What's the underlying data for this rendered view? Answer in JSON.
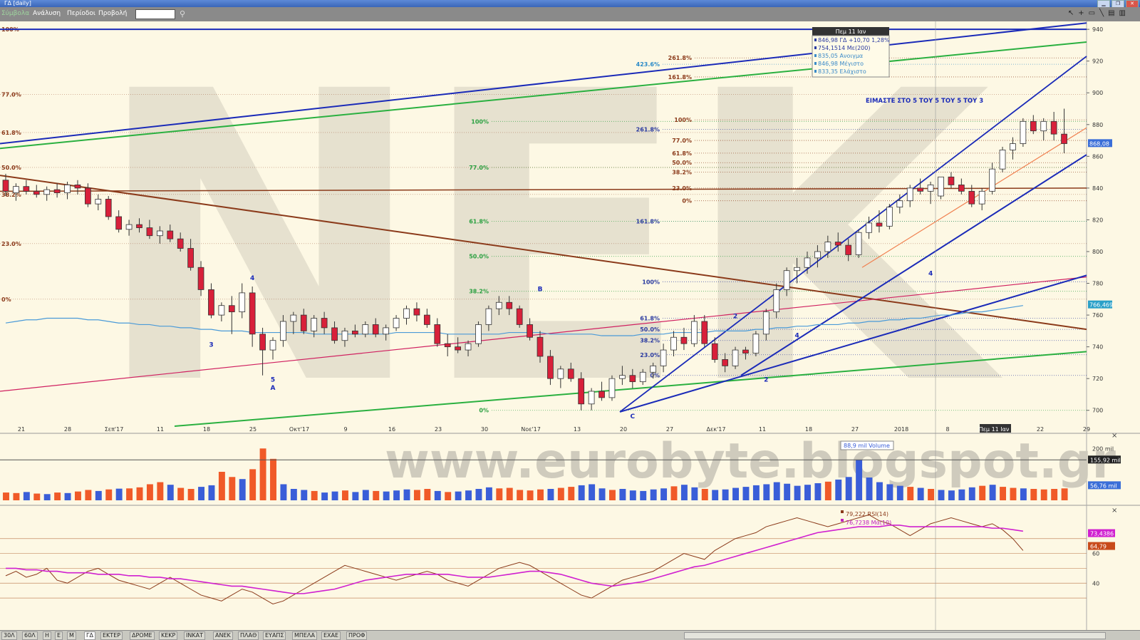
{
  "window": {
    "title": "ΓΔ [daily]"
  },
  "menu": [
    "Σύμβολα",
    "Ανάλυση",
    "Περίοδοι",
    "Προβολή"
  ],
  "watermark": "www.eurobyte.blogspot.gr",
  "crosshair_label": "Πεμ 11 Ιαν",
  "annotation": "ΕΙΜΑΣΤΕ ΣΤΟ 5 ΤΟΥ 5 ΤΟΥ 5 ΤΟΥ 3",
  "tooltip": {
    "header": "Πεμ 11 Ιαν",
    "lines": [
      {
        "text": "846,98 ΓΔ +10,70 1,28%",
        "color": "#2a3aa0"
      },
      {
        "text": "754,1514 Με(200)",
        "color": "#2a3aa0"
      },
      {
        "text": "835,05 Ανοιγμα",
        "color": "#3a8ac8"
      },
      {
        "text": "846,98 Μέγιστο",
        "color": "#3a8ac8"
      },
      {
        "text": "833,35 Ελάχιστο",
        "color": "#3a8ac8"
      }
    ]
  },
  "volume_legend": "88,9 mil Volume",
  "rsi_legend": [
    {
      "text": "79,222 RSI(14)",
      "color": "#8b3a1a"
    },
    {
      "text": "76,7238 Μα(10)",
      "color": "#c020c0"
    }
  ],
  "price_flags": [
    {
      "text": "868,08",
      "value": 868.08,
      "bg": "#3a6ed8"
    },
    {
      "text": "766,469",
      "value": 766.469,
      "bg": "#2aa0c8"
    }
  ],
  "volume_flags": [
    {
      "text": "155,92 mil",
      "value": 155.92,
      "bg": "#222"
    },
    {
      "text": "56,76 mil",
      "value": 56.76,
      "bg": "#3a6ed8"
    }
  ],
  "volume_axis": [
    {
      "text": "200 mil",
      "value": 200
    }
  ],
  "rsi_flags": [
    {
      "text": "73,4386",
      "value": 73.4386,
      "bg": "#d020d0"
    },
    {
      "text": "64,79",
      "value": 64.79,
      "bg": "#c84a1a"
    }
  ],
  "rsi_axis": [
    {
      "text": "60",
      "value": 60
    },
    {
      "text": "40",
      "value": 40
    }
  ],
  "bottom_tabs": [
    "30Λ",
    "60Λ",
    "Η",
    "Ε",
    "Μ",
    "ΓΔ",
    "ΕΚΤΕΡ",
    "ΔΡΟΜΕ",
    "ΚΕΚΡ",
    "ΙΝΚΑΤ",
    "ΑΝΕΚ",
    "ΠΛΑΘ",
    "ΕΥΑΠΣ",
    "ΜΠΕΛΑ",
    "ΕΧΑΕ",
    "ΠΡΟΦ"
  ],
  "chart_data": {
    "type": "candlestick",
    "ylim": [
      690,
      945
    ],
    "y_ticks": [
      700,
      720,
      740,
      760,
      780,
      800,
      820,
      840,
      860,
      880,
      900,
      920,
      940
    ],
    "x_labels": [
      "21",
      "28",
      "Σεπ'17",
      "11",
      "18",
      "25",
      "Οκτ'17",
      "9",
      "16",
      "23",
      "30",
      "Νοε'17",
      "13",
      "20",
      "27",
      "Δεκ'17",
      "11",
      "18",
      "27",
      "2018",
      "8",
      "Πεμ 11 Ιαν",
      "22",
      "29"
    ],
    "candles": [
      [
        845,
        849,
        835,
        838
      ],
      [
        837,
        843,
        832,
        841
      ],
      [
        841,
        845,
        836,
        838
      ],
      [
        838,
        842,
        834,
        836
      ],
      [
        836,
        841,
        832,
        839
      ],
      [
        839,
        843,
        834,
        837
      ],
      [
        837,
        844,
        833,
        842
      ],
      [
        842,
        845,
        836,
        840
      ],
      [
        840,
        843,
        828,
        830
      ],
      [
        830,
        836,
        826,
        833
      ],
      [
        833,
        835,
        820,
        822
      ],
      [
        822,
        826,
        812,
        814
      ],
      [
        814,
        820,
        810,
        817
      ],
      [
        817,
        821,
        812,
        815
      ],
      [
        815,
        820,
        808,
        810
      ],
      [
        810,
        816,
        805,
        813
      ],
      [
        813,
        817,
        806,
        808
      ],
      [
        808,
        812,
        800,
        802
      ],
      [
        802,
        808,
        788,
        790
      ],
      [
        790,
        794,
        772,
        776
      ],
      [
        776,
        780,
        758,
        760
      ],
      [
        760,
        768,
        756,
        766
      ],
      [
        766,
        772,
        748,
        762
      ],
      [
        762,
        780,
        758,
        774
      ],
      [
        774,
        778,
        740,
        748
      ],
      [
        748,
        752,
        722,
        738
      ],
      [
        738,
        746,
        732,
        744
      ],
      [
        744,
        760,
        740,
        756
      ],
      [
        756,
        762,
        748,
        760
      ],
      [
        760,
        764,
        748,
        750
      ],
      [
        750,
        760,
        746,
        758
      ],
      [
        758,
        762,
        748,
        752
      ],
      [
        752,
        756,
        742,
        744
      ],
      [
        744,
        752,
        740,
        750
      ],
      [
        750,
        754,
        746,
        748
      ],
      [
        748,
        756,
        746,
        754
      ],
      [
        754,
        758,
        746,
        748
      ],
      [
        748,
        754,
        744,
        752
      ],
      [
        752,
        760,
        750,
        758
      ],
      [
        758,
        766,
        754,
        764
      ],
      [
        764,
        768,
        756,
        760
      ],
      [
        760,
        764,
        752,
        754
      ],
      [
        754,
        758,
        740,
        742
      ],
      [
        742,
        748,
        734,
        740
      ],
      [
        740,
        746,
        736,
        738
      ],
      [
        738,
        744,
        734,
        742
      ],
      [
        742,
        756,
        740,
        754
      ],
      [
        754,
        766,
        750,
        764
      ],
      [
        764,
        772,
        760,
        768
      ],
      [
        768,
        772,
        760,
        764
      ],
      [
        764,
        766,
        752,
        754
      ],
      [
        754,
        758,
        744,
        746
      ],
      [
        746,
        750,
        730,
        734
      ],
      [
        734,
        738,
        716,
        720
      ],
      [
        720,
        728,
        714,
        726
      ],
      [
        726,
        730,
        718,
        720
      ],
      [
        720,
        724,
        700,
        704
      ],
      [
        704,
        714,
        700,
        712
      ],
      [
        712,
        718,
        706,
        708
      ],
      [
        708,
        722,
        706,
        720
      ],
      [
        720,
        728,
        716,
        722
      ],
      [
        722,
        726,
        714,
        718
      ],
      [
        718,
        726,
        716,
        724
      ],
      [
        724,
        730,
        720,
        728
      ],
      [
        728,
        742,
        724,
        738
      ],
      [
        738,
        750,
        734,
        746
      ],
      [
        746,
        752,
        738,
        742
      ],
      [
        742,
        760,
        740,
        756
      ],
      [
        756,
        760,
        740,
        742
      ],
      [
        742,
        746,
        730,
        732
      ],
      [
        732,
        736,
        724,
        728
      ],
      [
        728,
        740,
        726,
        738
      ],
      [
        738,
        740,
        732,
        736
      ],
      [
        736,
        750,
        734,
        748
      ],
      [
        748,
        764,
        744,
        762
      ],
      [
        762,
        780,
        758,
        776
      ],
      [
        776,
        790,
        772,
        788
      ],
      [
        788,
        796,
        780,
        790
      ],
      [
        790,
        800,
        786,
        796
      ],
      [
        796,
        804,
        790,
        800
      ],
      [
        800,
        810,
        796,
        806
      ],
      [
        806,
        812,
        800,
        804
      ],
      [
        804,
        808,
        794,
        798
      ],
      [
        798,
        814,
        796,
        812
      ],
      [
        812,
        822,
        808,
        818
      ],
      [
        818,
        826,
        812,
        816
      ],
      [
        816,
        830,
        814,
        828
      ],
      [
        828,
        836,
        824,
        832
      ],
      [
        832,
        842,
        828,
        840
      ],
      [
        840,
        846,
        836,
        838
      ],
      [
        838,
        844,
        830,
        842
      ],
      [
        835,
        847,
        833,
        847
      ],
      [
        847,
        850,
        840,
        842
      ],
      [
        842,
        846,
        836,
        838
      ],
      [
        838,
        842,
        828,
        830
      ],
      [
        830,
        840,
        826,
        838
      ],
      [
        838,
        856,
        836,
        852
      ],
      [
        852,
        866,
        850,
        864
      ],
      [
        864,
        872,
        858,
        868
      ],
      [
        868,
        884,
        866,
        882
      ],
      [
        882,
        886,
        874,
        876
      ],
      [
        876,
        884,
        870,
        882
      ],
      [
        882,
        888,
        870,
        874
      ],
      [
        874,
        890,
        862,
        868
      ]
    ],
    "ma200": [
      755,
      756,
      757,
      757,
      758,
      758,
      758,
      758,
      757,
      757,
      756,
      755,
      755,
      754,
      754,
      753,
      753,
      752,
      752,
      751,
      751,
      750,
      750,
      750,
      749,
      749,
      749,
      749,
      749,
      749,
      748,
      748,
      748,
      748,
      748,
      748,
      748,
      748,
      749,
      749,
      749,
      749,
      749,
      748,
      748,
      748,
      748,
      748,
      748,
      749,
      749,
      749,
      749,
      748,
      748,
      748,
      748,
      748,
      747,
      747,
      747,
      747,
      748,
      748,
      748,
      749,
      749,
      749,
      749,
      750,
      750,
      750,
      750,
      751,
      751,
      752,
      752,
      753,
      753,
      754,
      754,
      754,
      755,
      755,
      756,
      756,
      757,
      757,
      758,
      758,
      759,
      760,
      760,
      761,
      762,
      762,
      763,
      764,
      765,
      766
    ],
    "volume": [
      30,
      28,
      32,
      26,
      24,
      30,
      28,
      34,
      40,
      36,
      42,
      45,
      46,
      50,
      62,
      70,
      60,
      48,
      44,
      52,
      58,
      110,
      90,
      82,
      120,
      200,
      160,
      62,
      44,
      40,
      36,
      30,
      34,
      38,
      32,
      40,
      36,
      34,
      38,
      42,
      40,
      44,
      36,
      32,
      34,
      38,
      44,
      50,
      46,
      48,
      40,
      38,
      42,
      44,
      48,
      52,
      58,
      62,
      46,
      40,
      44,
      38,
      36,
      42,
      46,
      54,
      60,
      50,
      44,
      40,
      42,
      48,
      52,
      58,
      62,
      70,
      64,
      56,
      60,
      66,
      72,
      80,
      90,
      156,
      88,
      70,
      62,
      56,
      52,
      48,
      44,
      40,
      38,
      42,
      50,
      56,
      60,
      52,
      48,
      46,
      44,
      42,
      44,
      46
    ],
    "volume_up": [
      0,
      0,
      1,
      0,
      1,
      0,
      1,
      0,
      0,
      1,
      0,
      1,
      0,
      0,
      0,
      0,
      1,
      0,
      0,
      1,
      1,
      0,
      0,
      1,
      0,
      0,
      0,
      1,
      1,
      1,
      0,
      1,
      1,
      0,
      1,
      1,
      0,
      1,
      1,
      1,
      0,
      0,
      1,
      0,
      1,
      1,
      1,
      1,
      0,
      0,
      0,
      0,
      0,
      1,
      0,
      0,
      1,
      1,
      1,
      0,
      1,
      1,
      1,
      1,
      1,
      0,
      1,
      1,
      0,
      1,
      1,
      1,
      1,
      1,
      1,
      1,
      1,
      1,
      1,
      1,
      0,
      1,
      1,
      1,
      1,
      1,
      1,
      1,
      0,
      1,
      0,
      1,
      1,
      1,
      1,
      0,
      1,
      0,
      0,
      1
    ],
    "rsi": [
      45,
      48,
      44,
      46,
      50,
      42,
      40,
      44,
      48,
      50,
      46,
      42,
      40,
      38,
      36,
      40,
      44,
      40,
      36,
      32,
      30,
      28,
      32,
      36,
      34,
      30,
      26,
      28,
      32,
      36,
      40,
      44,
      48,
      52,
      50,
      48,
      46,
      44,
      42,
      44,
      46,
      48,
      46,
      42,
      40,
      38,
      42,
      46,
      50,
      52,
      54,
      52,
      48,
      44,
      40,
      36,
      32,
      30,
      34,
      38,
      42,
      44,
      46,
      48,
      52,
      56,
      60,
      58,
      56,
      62,
      66,
      70,
      72,
      74,
      78,
      80,
      82,
      84,
      82,
      80,
      78,
      80,
      82,
      84,
      86,
      82,
      80,
      76,
      72,
      76,
      80,
      82,
      84,
      82,
      80,
      78,
      80,
      76,
      70,
      62
    ],
    "rsi_ma": [
      50,
      50,
      49,
      49,
      48,
      48,
      47,
      47,
      47,
      46,
      46,
      46,
      45,
      45,
      44,
      44,
      43,
      43,
      42,
      41,
      40,
      39,
      38,
      38,
      37,
      36,
      35,
      34,
      33,
      33,
      34,
      35,
      36,
      38,
      40,
      42,
      43,
      44,
      45,
      46,
      46,
      46,
      46,
      46,
      45,
      44,
      44,
      44,
      45,
      46,
      47,
      48,
      48,
      47,
      46,
      44,
      42,
      40,
      39,
      38,
      39,
      40,
      41,
      43,
      45,
      47,
      49,
      51,
      52,
      54,
      56,
      58,
      60,
      62,
      64,
      66,
      68,
      70,
      72,
      74,
      75,
      76,
      77,
      78,
      78,
      78,
      79,
      79,
      78,
      78,
      78,
      78,
      78,
      78,
      78,
      78,
      77,
      77,
      76,
      75
    ],
    "fib_levels": [
      {
        "label": "423.6%",
        "value": 918,
        "color": "#2a8ac8"
      },
      {
        "label": "261.8%",
        "value": 877,
        "color": "#2a3aa0"
      },
      {
        "label": "161.8%",
        "value": 819,
        "color": "#2a3aa0"
      },
      {
        "label": "100%",
        "value": 781,
        "color": "#2a3aa0"
      },
      {
        "label": "61.8%",
        "value": 758,
        "color": "#2a3aa0"
      },
      {
        "label": "50.0%",
        "value": 751,
        "color": "#2a3aa0"
      },
      {
        "label": "38.2%",
        "value": 744,
        "color": "#2a3aa0"
      },
      {
        "label": "23.0%",
        "value": 735,
        "color": "#2a3aa0"
      },
      {
        "label": "0%",
        "value": 722,
        "color": "#2a3aa0"
      },
      {
        "label": "100%",
        "value": 882,
        "color": "#2aa040"
      },
      {
        "label": "77.0%",
        "value": 853,
        "color": "#2aa040"
      },
      {
        "label": "61.8%",
        "value": 819,
        "color": "#2aa040"
      },
      {
        "label": "50.0%",
        "value": 797,
        "color": "#2aa040"
      },
      {
        "label": "38.2%",
        "value": 775,
        "color": "#2aa040"
      },
      {
        "label": "0%",
        "value": 700,
        "color": "#2aa040"
      },
      {
        "label": "261.8%",
        "value": 922,
        "color": "#8b3a1a"
      },
      {
        "label": "161.8%",
        "value": 910,
        "color": "#8b3a1a"
      },
      {
        "label": "100%",
        "value": 883,
        "color": "#8b3a1a"
      },
      {
        "label": "77.0%",
        "value": 870,
        "color": "#8b3a1a"
      },
      {
        "label": "61.8%",
        "value": 862,
        "color": "#8b3a1a"
      },
      {
        "label": "50.0%",
        "value": 856,
        "color": "#8b3a1a"
      },
      {
        "label": "38.2%",
        "value": 850,
        "color": "#8b3a1a"
      },
      {
        "label": "23.0%",
        "value": 840,
        "color": "#8b3a1a"
      },
      {
        "label": "0%",
        "value": 832,
        "color": "#8b3a1a"
      }
    ],
    "left_pct": [
      {
        "label": "100%",
        "value": 940
      },
      {
        "label": "77.0%",
        "value": 899
      },
      {
        "label": "61.8%",
        "value": 875
      },
      {
        "label": "50.0%",
        "value": 853
      },
      {
        "label": "38.2%",
        "value": 836
      },
      {
        "label": "23.0%",
        "value": 805
      },
      {
        "label": "0%",
        "value": 770
      }
    ],
    "wave_labels": [
      {
        "text": "4",
        "i": 24,
        "value": 782
      },
      {
        "text": "3",
        "i": 20,
        "value": 740
      },
      {
        "text": "5",
        "i": 26,
        "value": 718
      },
      {
        "text": "A",
        "i": 26,
        "value": 713
      },
      {
        "text": "B",
        "i": 52,
        "value": 775
      },
      {
        "text": "C",
        "i": 61,
        "value": 695
      },
      {
        "text": "2",
        "i": 74,
        "value": 718
      },
      {
        "text": "4",
        "i": 77,
        "value": 746
      },
      {
        "text": "4",
        "i": 90,
        "value": 785
      },
      {
        "text": "2",
        "i": 71,
        "value": 758
      }
    ]
  }
}
